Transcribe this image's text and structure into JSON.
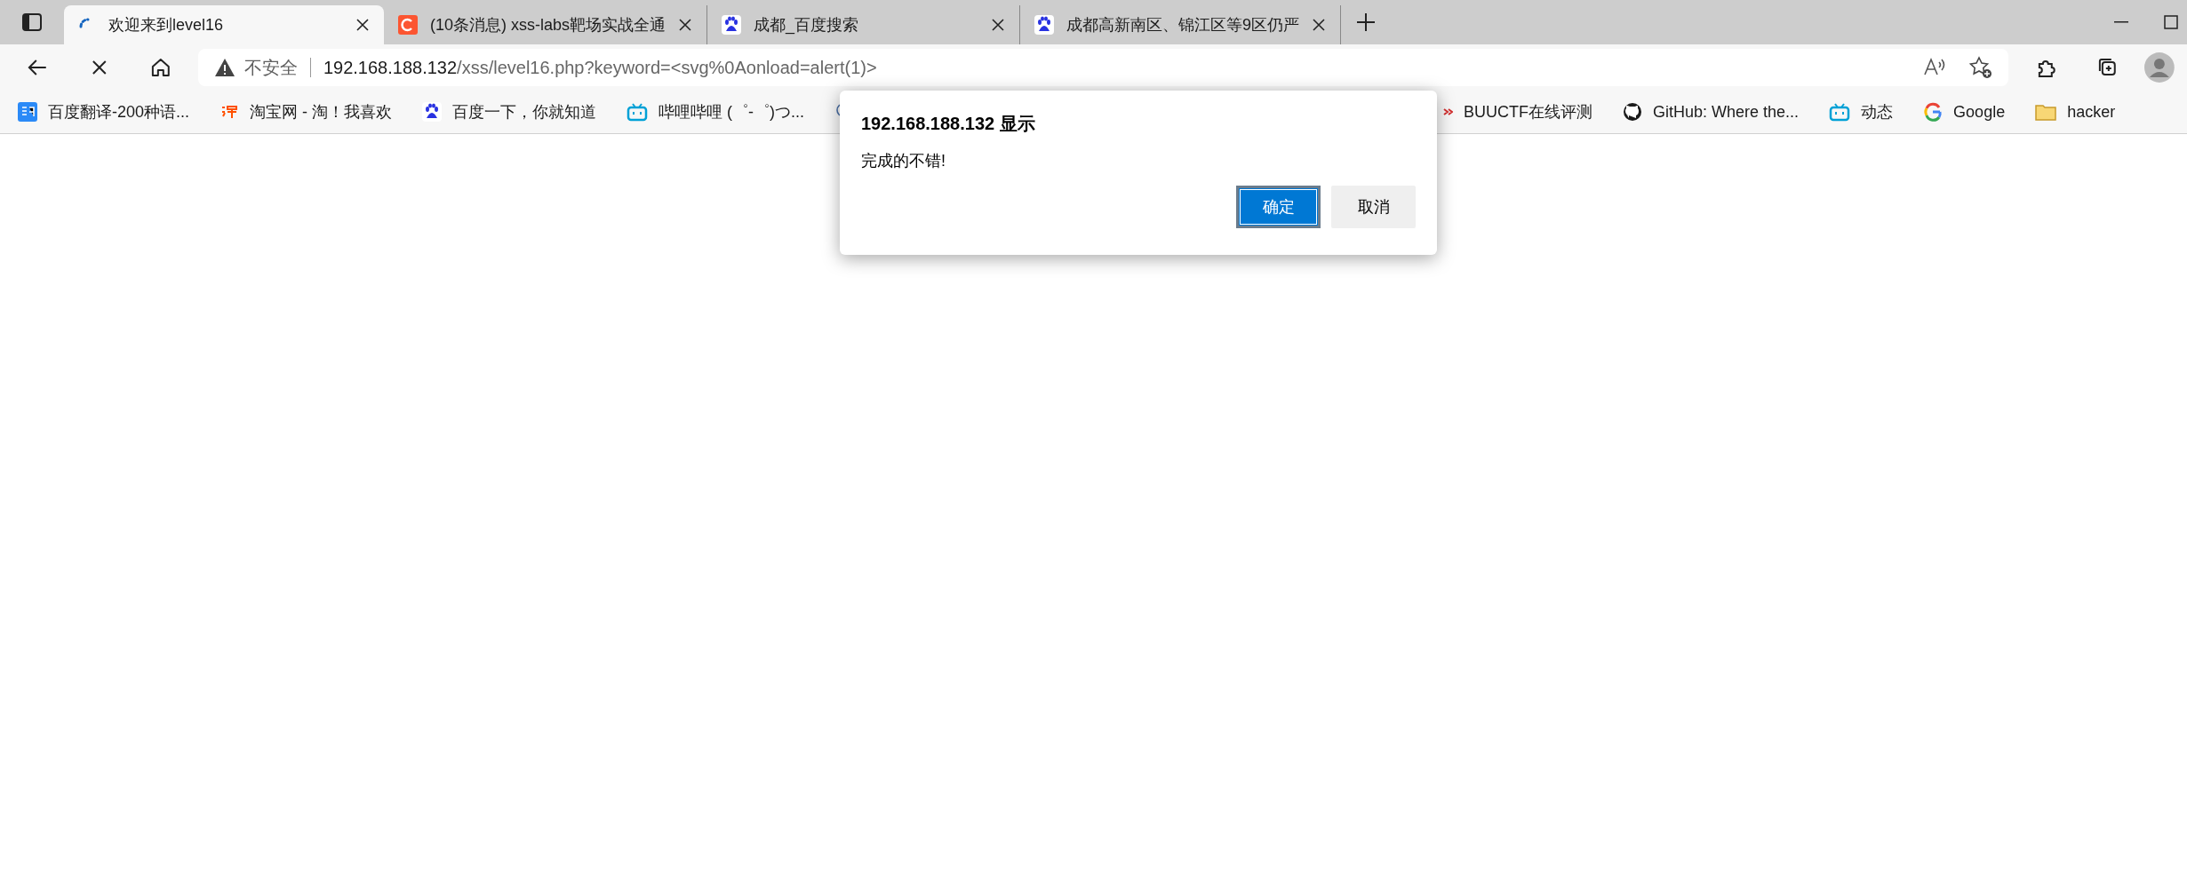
{
  "tabs": [
    {
      "title": "欢迎来到level16",
      "selected": true
    },
    {
      "title": "(10条消息) xss-labs靶场实战全通",
      "selected": false
    },
    {
      "title": "成都_百度搜索",
      "selected": false
    },
    {
      "title": "成都高新南区、锦江区等9区仍严",
      "selected": false
    }
  ],
  "address_bar": {
    "security": "不安全",
    "host": "192.168.188.132",
    "path": "/xss/level16.php?keyword=<svg%0Aonload=alert(1)>"
  },
  "bookmarks": [
    {
      "label": "百度翻译-200种语..."
    },
    {
      "label": "淘宝网 - 淘！我喜欢"
    },
    {
      "label": "百度一下，你就知道"
    },
    {
      "label": "哔哩哔哩 (゜-゜)つ..."
    }
  ],
  "bookmarks_right": [
    {
      "label": "BUUCTF在线评测"
    },
    {
      "label": "GitHub: Where the..."
    },
    {
      "label": "动态"
    },
    {
      "label": "Google"
    },
    {
      "label": "hacker"
    }
  ],
  "dialog": {
    "title": "192.168.188.132 显示",
    "message": "完成的不错!",
    "buttons": [
      {
        "label": "确定",
        "primary": true
      },
      {
        "label": "取消",
        "primary": false
      }
    ]
  }
}
